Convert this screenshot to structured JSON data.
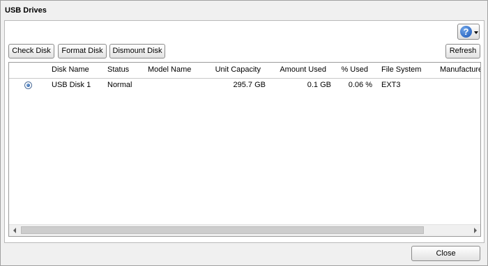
{
  "window": {
    "title": "USB Drives"
  },
  "toolbar": {
    "check_disk": "Check Disk",
    "format_disk": "Format Disk",
    "dismount_disk": "Dismount Disk",
    "refresh": "Refresh",
    "help_glyph": "?"
  },
  "table": {
    "columns": [
      "Disk Name",
      "Status",
      "Model Name",
      "Unit Capacity",
      "Amount Used",
      "% Used",
      "File System",
      "Manufacture"
    ],
    "rows": [
      {
        "selected": true,
        "disk_name": "USB Disk 1",
        "status": "Normal",
        "model_name": "",
        "unit_capacity": "295.7 GB",
        "amount_used": "0.1 GB",
        "percent_used": "0.06 %",
        "file_system": "EXT3",
        "manufacture": ""
      }
    ]
  },
  "footer": {
    "close": "Close"
  },
  "icons": {
    "help": "help-icon",
    "dropdown": "chevron-down-icon",
    "radio": "radio-selected-icon"
  }
}
